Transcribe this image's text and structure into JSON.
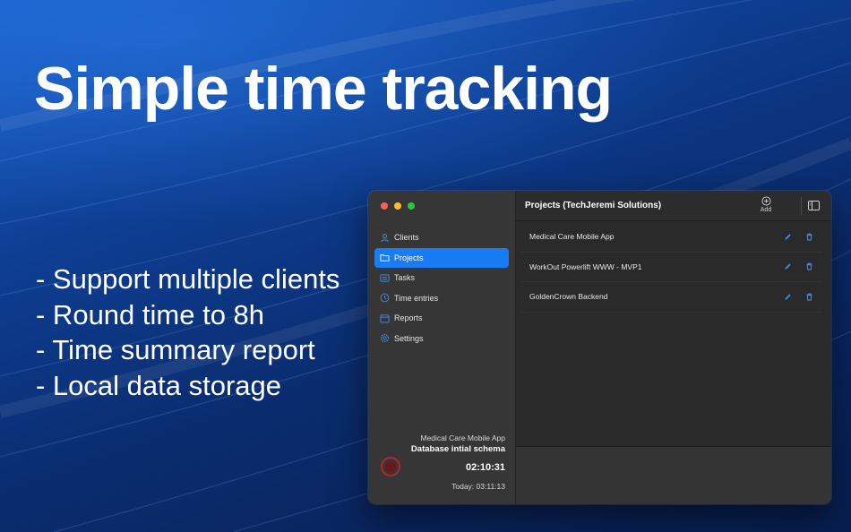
{
  "headline": "Simple time tracking",
  "bullets": [
    "- Support multiple clients",
    "- Round time to 8h",
    "- Time summary report",
    "- Local data storage"
  ],
  "sidebar": {
    "items": [
      {
        "label": "Clients",
        "icon": "person-icon",
        "active": false
      },
      {
        "label": "Projects",
        "icon": "folder-icon",
        "active": true
      },
      {
        "label": "Tasks",
        "icon": "list-icon",
        "active": false
      },
      {
        "label": "Time entries",
        "icon": "clock-icon",
        "active": false
      },
      {
        "label": "Reports",
        "icon": "calendar-icon",
        "active": false
      },
      {
        "label": "Settings",
        "icon": "gear-icon",
        "active": false
      }
    ],
    "footer": {
      "project": "Medical Care Mobile App",
      "task": "Database intial schema",
      "timer": "02:10:31",
      "today": "Today: 03:11:13"
    }
  },
  "toolbar": {
    "title": "Projects (TechJeremi Solutions)",
    "add_label": "Add"
  },
  "projects": [
    {
      "name": "Medical Care Mobile App"
    },
    {
      "name": "WorkOut Powerlift WWW - MVP1"
    },
    {
      "name": "GoldenCrown Backend"
    }
  ],
  "colors": {
    "accent": "#1a7cf5",
    "record": "#b3262b"
  }
}
